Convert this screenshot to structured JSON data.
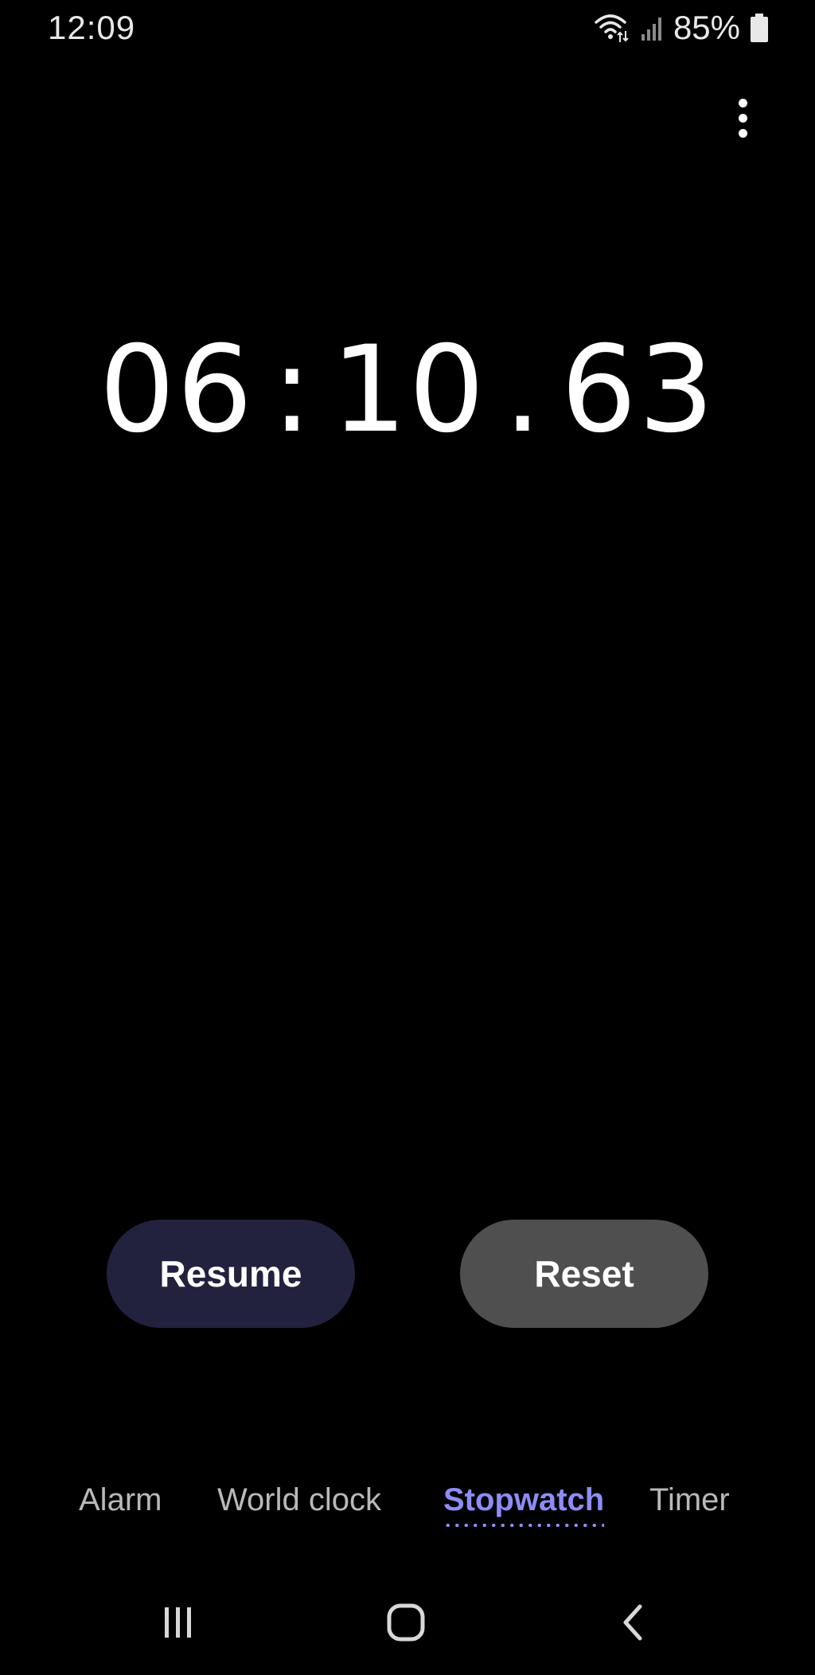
{
  "status_bar": {
    "time": "12:09",
    "battery_percent": "85%",
    "icons": [
      "wifi-icon",
      "signal-icon",
      "battery-icon"
    ]
  },
  "toolbar": {
    "more_icon": "more-vertical-icon"
  },
  "stopwatch": {
    "minutes": "06",
    "separator_1": ":",
    "seconds": "10",
    "separator_2": ".",
    "hundredths": "63"
  },
  "actions": {
    "resume_label": "Resume",
    "reset_label": "Reset"
  },
  "tabs": [
    {
      "label": "Alarm",
      "active": false
    },
    {
      "label": "World clock",
      "active": false
    },
    {
      "label": "Stopwatch",
      "active": true
    },
    {
      "label": "Timer",
      "active": false
    }
  ],
  "nav_bar": {
    "icons": [
      "recent-apps-icon",
      "home-icon",
      "back-icon"
    ]
  },
  "colors": {
    "background": "#000000",
    "accent": "#8e8cf5",
    "resume_button": "#22223f",
    "reset_button": "#4f4f4f"
  }
}
